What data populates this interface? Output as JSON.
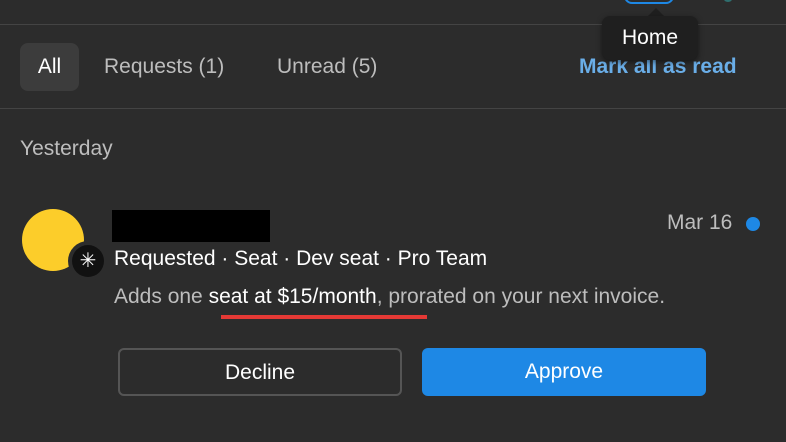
{
  "tooltip": {
    "label": "Home"
  },
  "tabs": {
    "all": "All",
    "requests": "Requests (1)",
    "unread": "Unread (5)"
  },
  "mark_all_label": "Mark all as read",
  "section": {
    "heading": "Yesterday"
  },
  "notification": {
    "date": "Mar 16",
    "summary": "Requested · Seat · Dev seat · Pro Team",
    "description_prefix": "Adds one ",
    "description_highlight": "seat at $15/month",
    "description_suffix": ", prorated on your next invoice.",
    "badge_icon": "asterisk-icon",
    "unread": true
  },
  "actions": {
    "decline_label": "Decline",
    "approve_label": "Approve"
  },
  "colors": {
    "background": "#2c2c2c",
    "accent": "#1e88e5",
    "link": "#6aaee8",
    "avatar": "#fccd2a",
    "annotation_underline": "#e53935"
  }
}
